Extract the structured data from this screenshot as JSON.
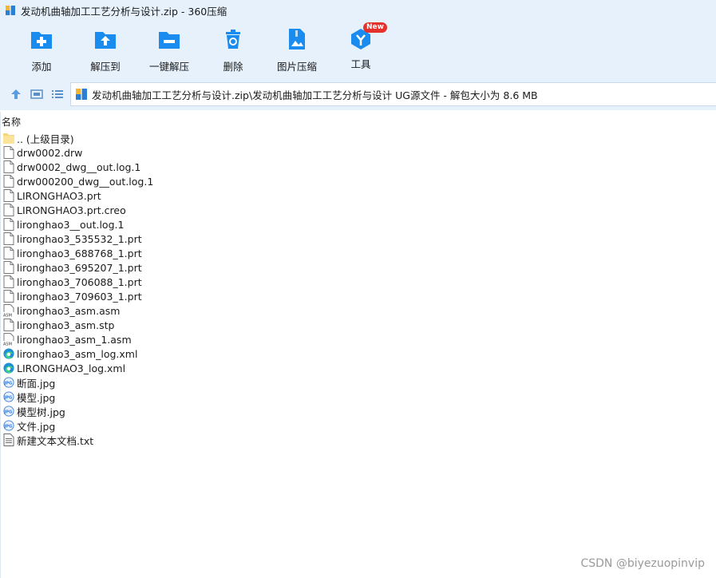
{
  "window": {
    "title": "发动机曲轴加工工艺分析与设计.zip - 360压缩"
  },
  "toolbar": {
    "add": "添加",
    "extract_to": "解压到",
    "one_click_extract": "一键解压",
    "delete": "删除",
    "image_compress": "图片压缩",
    "tools": "工具",
    "tools_badge": "New"
  },
  "address": {
    "path": "发动机曲轴加工工艺分析与设计.zip\\发动机曲轴加工工艺分析与设计 UG源文件 - 解包大小为 8.6 MB"
  },
  "columns": {
    "name": "名称"
  },
  "files": [
    {
      "name": ".. (上级目录)",
      "icon": "folder-up-icon"
    },
    {
      "name": "drw0002.drw",
      "icon": "file-icon"
    },
    {
      "name": "drw0002_dwg__out.log.1",
      "icon": "file-icon"
    },
    {
      "name": "drw000200_dwg__out.log.1",
      "icon": "file-icon"
    },
    {
      "name": "LIRONGHAO3.prt",
      "icon": "file-icon"
    },
    {
      "name": "LIRONGHAO3.prt.creo",
      "icon": "file-icon"
    },
    {
      "name": "lironghao3__out.log.1",
      "icon": "file-icon"
    },
    {
      "name": "lironghao3_535532_1.prt",
      "icon": "file-icon"
    },
    {
      "name": "lironghao3_688768_1.prt",
      "icon": "file-icon"
    },
    {
      "name": "lironghao3_695207_1.prt",
      "icon": "file-icon"
    },
    {
      "name": "lironghao3_706088_1.prt",
      "icon": "file-icon"
    },
    {
      "name": "lironghao3_709603_1.prt",
      "icon": "file-icon"
    },
    {
      "name": "lironghao3_asm.asm",
      "icon": "asm-file-icon"
    },
    {
      "name": "lironghao3_asm.stp",
      "icon": "file-icon"
    },
    {
      "name": "lironghao3_asm_1.asm",
      "icon": "asm-file-icon"
    },
    {
      "name": "lironghao3_asm_log.xml",
      "icon": "edge-xml-icon"
    },
    {
      "name": "LIRONGHAO3_log.xml",
      "icon": "edge-xml-icon"
    },
    {
      "name": "断面.jpg",
      "icon": "jpg-icon"
    },
    {
      "name": "模型.jpg",
      "icon": "jpg-icon"
    },
    {
      "name": "模型树.jpg",
      "icon": "jpg-icon"
    },
    {
      "name": "文件.jpg",
      "icon": "jpg-icon"
    },
    {
      "name": "新建文本文档.txt",
      "icon": "txt-icon"
    }
  ],
  "watermark": "CSDN @biyezuopinvip",
  "colors": {
    "accent": "#1a8cf0",
    "toolbar_bg": "#e6f1fb",
    "badge": "#e4312b"
  }
}
